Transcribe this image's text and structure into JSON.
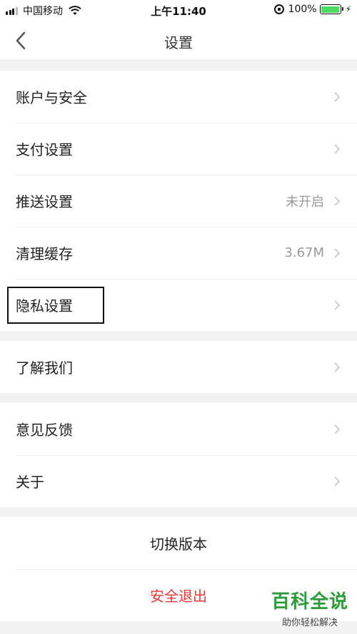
{
  "status_bar": {
    "carrier": "中国移动",
    "time": "上午11:40",
    "battery": "100%"
  },
  "nav": {
    "title": "设置"
  },
  "groups": [
    {
      "items": [
        {
          "label": "账户与安全",
          "value": ""
        },
        {
          "label": "支付设置",
          "value": ""
        },
        {
          "label": "推送设置",
          "value": "未开启"
        },
        {
          "label": "清理缓存",
          "value": "3.67M"
        },
        {
          "label": "隐私设置",
          "value": ""
        }
      ]
    },
    {
      "items": [
        {
          "label": "了解我们",
          "value": ""
        }
      ]
    },
    {
      "items": [
        {
          "label": "意见反馈",
          "value": ""
        },
        {
          "label": "关于",
          "value": ""
        }
      ]
    }
  ],
  "actions": {
    "switch_version": "切换版本",
    "logout": "安全退出"
  },
  "watermark": {
    "main": "百科全说",
    "sub": "助你轻松解决"
  },
  "colors": {
    "logout": "#e53935",
    "battery": "#4cd964",
    "watermark": "#2e9b3a"
  }
}
